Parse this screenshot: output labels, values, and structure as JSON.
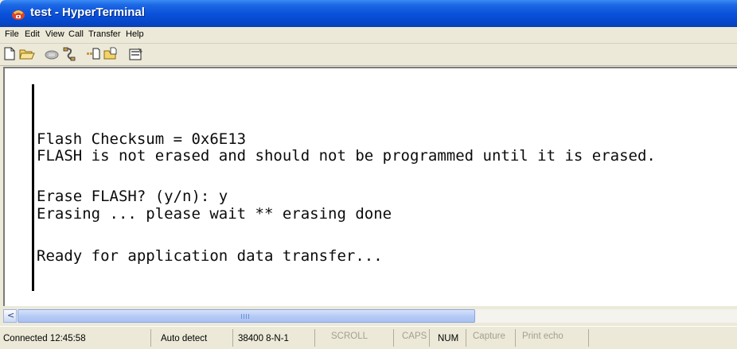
{
  "window": {
    "title": "test - HyperTerminal",
    "icon": "hyperterminal-phone-icon"
  },
  "menu": {
    "items": [
      "File",
      "Edit",
      "View",
      "Call",
      "Transfer",
      "Help"
    ]
  },
  "toolbar": {
    "buttons": [
      {
        "name": "new-connection",
        "icon": "new-document-icon"
      },
      {
        "name": "open",
        "icon": "open-folder-icon"
      },
      {
        "name": "call",
        "icon": "phone-icon"
      },
      {
        "name": "disconnect",
        "icon": "disconnect-icon"
      },
      {
        "name": "send",
        "icon": "send-file-icon"
      },
      {
        "name": "receive",
        "icon": "receive-file-icon"
      },
      {
        "name": "properties",
        "icon": "properties-icon"
      }
    ]
  },
  "terminal": {
    "lines": [
      "Flash Checksum = 0x6E13",
      "FLASH is not erased and should not be programmed until it is erased.",
      "Erase FLASH? (y/n): y",
      "Erasing ... please wait ** erasing done",
      "Ready for application data transfer..."
    ]
  },
  "statusbar": {
    "connected": "Connected 12:45:58",
    "detect": "Auto detect",
    "settings": "38400 8-N-1",
    "scroll": "SCROLL",
    "caps": "CAPS",
    "num": "NUM",
    "capture": "Capture",
    "print_echo": "Print echo"
  },
  "colors": {
    "titlebar": "#0a52db",
    "chrome": "#ece9d8",
    "terminal_bg": "#ffffff",
    "terminal_text": "#0b0b0b"
  }
}
